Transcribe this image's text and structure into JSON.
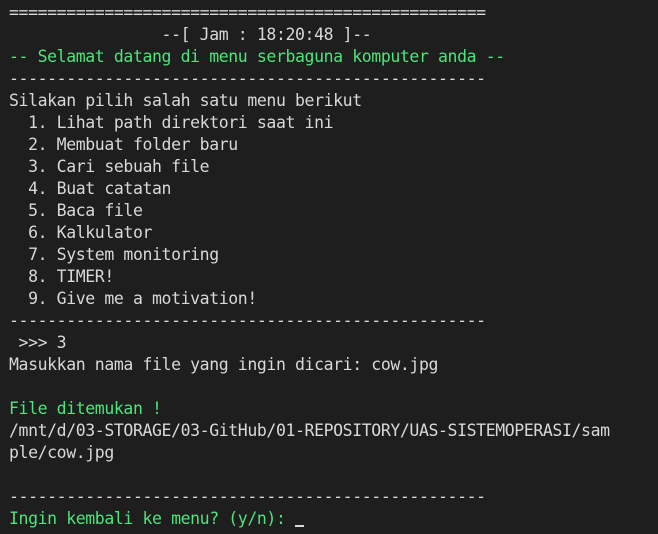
{
  "terminal": {
    "separator_double": "==================================================",
    "clock_line": "                --[ Jam : 18:20:48 ]--",
    "welcome_line": "-- Selamat datang di menu serbaguna komputer anda --",
    "separator_single": "--------------------------------------------------",
    "menu_prompt": "Silakan pilih salah satu menu berikut",
    "menu_items": [
      "  1. Lihat path direktori saat ini",
      "  2. Membuat folder baru",
      "  3. Cari sebuah file",
      "  4. Buat catatan",
      "  5. Baca file",
      "  6. Kalkulator",
      "  7. System monitoring",
      "  8. TIMER!",
      "  9. Give me a motivation!"
    ],
    "choice_input": " >>> 3",
    "filename_prompt": "Masukkan nama file yang ingin dicari: cow.jpg",
    "found_message": "File ditemukan !",
    "found_path_line1": "/mnt/d/03-STORAGE/03-GitHub/01-REPOSITORY/UAS-SISTEMOPERASI/sam",
    "found_path_line2": "ple/cow.jpg",
    "return_prompt": "Ingin kembali ke menu? (y/n): "
  },
  "colors": {
    "background": "#1e1e1e",
    "text": "#d8d8d8",
    "accent_green": "#50e37a"
  }
}
